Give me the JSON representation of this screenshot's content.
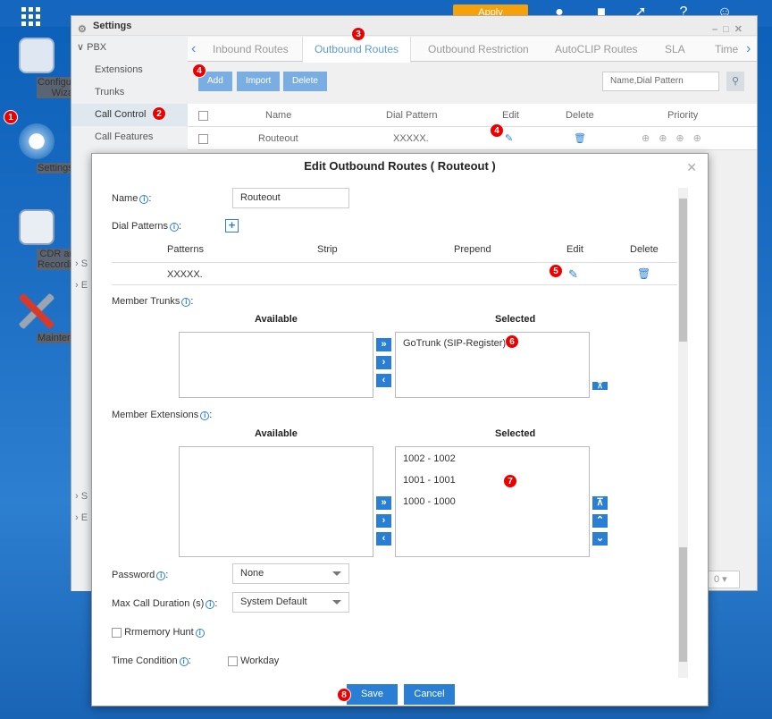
{
  "desktop": {
    "icons": [
      {
        "label": "Configuration Wizard",
        "icon": "configuration-wizard-icon"
      },
      {
        "label": "Settings",
        "icon": "gear-icon"
      },
      {
        "label": "CDR and Recording",
        "icon": "cdr-recording-icon"
      },
      {
        "label": "Maintenance",
        "icon": "wrench-screwdriver-icon"
      }
    ],
    "topbar": {
      "apply_label": "Apply",
      "window_tab": "Settings"
    }
  },
  "settings_window": {
    "title": "Settings",
    "sidebar": {
      "section": "PBX",
      "items": [
        "Extensions",
        "Trunks",
        "Call Control",
        "Call Features"
      ],
      "active": "Call Control",
      "collapsed_letters": [
        "S",
        "E",
        "S",
        "E"
      ]
    },
    "tabs": [
      "Inbound Routes",
      "Outbound Routes",
      "Outbound Restriction",
      "AutoCLIP Routes",
      "SLA",
      "Time"
    ],
    "active_tab": "Outbound Routes",
    "toolbar": {
      "add": "Add",
      "import": "Import",
      "delete": "Delete",
      "search_placeholder": "Name,Dial Pattern"
    },
    "table": {
      "columns": [
        "Name",
        "Dial Pattern",
        "Edit",
        "Delete",
        "Priority"
      ],
      "rows": [
        {
          "name": "Routeout",
          "dial_pattern": "XXXXX."
        }
      ]
    },
    "pager_value": "0"
  },
  "modal": {
    "title": "Edit Outbound Routes ( Routeout )",
    "name_label": "Name",
    "name_value": "Routeout",
    "dial_patterns_label": "Dial Patterns",
    "pattern_columns": [
      "Patterns",
      "Strip",
      "Prepend",
      "Edit",
      "Delete"
    ],
    "pattern_rows": [
      {
        "pattern": "XXXXX.",
        "strip": "",
        "prepend": ""
      }
    ],
    "member_trunks_label": "Member Trunks",
    "available_label": "Available",
    "selected_label": "Selected",
    "trunks_selected": [
      "GoTrunk (SIP-Register)"
    ],
    "member_extensions_label": "Member Extensions",
    "extensions_selected": [
      "1002 - 1002",
      "1001 - 1001",
      "1000 - 1000"
    ],
    "password_label": "Password",
    "password_value": "None",
    "max_duration_label": "Max Call Duration (s)",
    "max_duration_value": "System Default",
    "rrmemory_label": "Rrmemory Hunt",
    "time_condition_label": "Time Condition",
    "workday_label": "Workday",
    "save_label": "Save",
    "cancel_label": "Cancel",
    "colon": ":"
  },
  "badges": [
    "1",
    "2",
    "3",
    "4",
    "4",
    "5",
    "6",
    "7",
    "8"
  ],
  "colors": {
    "accent": "#2a7fd4",
    "badge": "#e00000",
    "apply": "#f5a20a"
  }
}
